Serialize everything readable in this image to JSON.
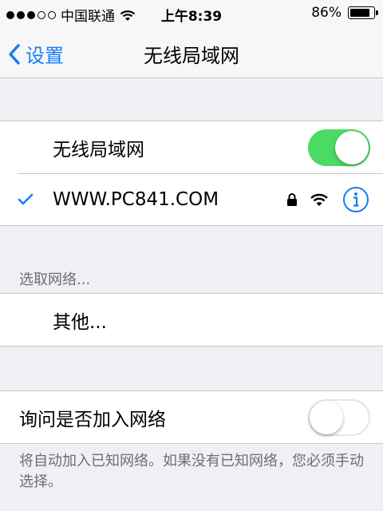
{
  "status_bar": {
    "carrier": "中国联通",
    "time": "上午8:39",
    "battery": "86%",
    "battery_level": 0.86
  },
  "nav": {
    "back_label": "设置",
    "title": "无线局域网"
  },
  "wifi_toggle": {
    "label": "无线局域网",
    "on": true
  },
  "connected_network": {
    "name": "WWW.PC841.COM",
    "checked": true
  },
  "choose_network": {
    "header": "选取网络...",
    "other_label": "其他..."
  },
  "ask_to_join": {
    "label": "询问是否加入网络",
    "on": false,
    "footer": "将自动加入已知网络。如果没有已知网络，您必须手动选择。"
  },
  "colors": {
    "accent": "#157efb",
    "toggle_on": "#4cd964",
    "background": "#efeff4"
  }
}
